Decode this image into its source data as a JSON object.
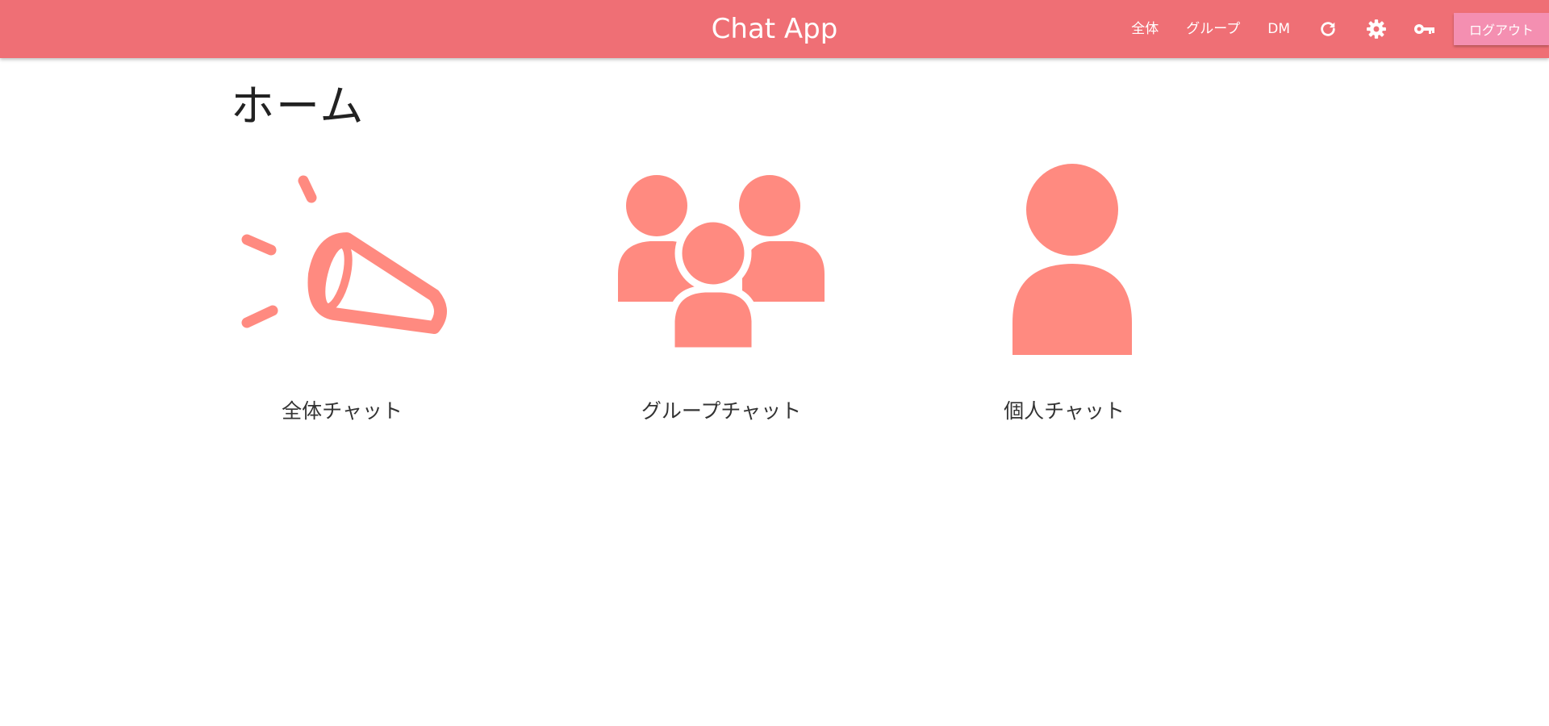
{
  "app": {
    "title": "Chat App"
  },
  "nav": {
    "links": [
      {
        "label": "全体"
      },
      {
        "label": "グループ"
      },
      {
        "label": "DM"
      }
    ],
    "icons": [
      "refresh-icon",
      "gear-icon",
      "key-icon"
    ],
    "logout_label": "ログアウト"
  },
  "page": {
    "title": "ホーム"
  },
  "cards": [
    {
      "label": "全体チャット",
      "icon": "megaphone-icon"
    },
    {
      "label": "グループチャット",
      "icon": "group-icon"
    },
    {
      "label": "個人チャット",
      "icon": "person-icon"
    }
  ],
  "colors": {
    "navbar": "#ef6f75",
    "accent_icon": "#ff8a80",
    "logout_button": "#f48fb1"
  }
}
